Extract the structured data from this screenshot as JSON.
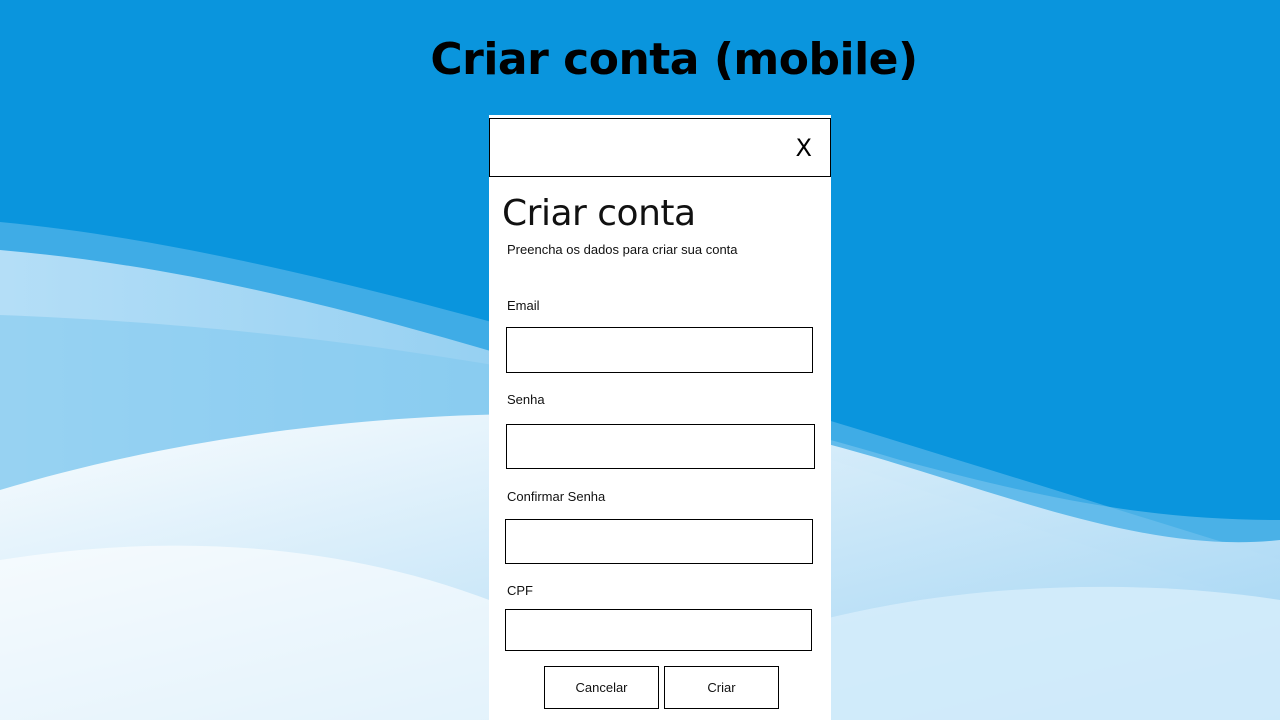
{
  "slide": {
    "title": "Criar conta (mobile)"
  },
  "dialog": {
    "close_label": "X",
    "title": "Criar conta",
    "subtitle": "Preencha os dados para criar sua conta",
    "fields": [
      {
        "label": "Email",
        "value": "",
        "placeholder": ""
      },
      {
        "label": "Senha",
        "value": "",
        "placeholder": ""
      },
      {
        "label": "Confirmar Senha",
        "value": "",
        "placeholder": ""
      },
      {
        "label": "CPF",
        "value": "",
        "placeholder": ""
      }
    ],
    "cancel_label": "Cancelar",
    "create_label": "Criar"
  },
  "colors": {
    "background_blue": "#0a95dd",
    "wave_light": "#e8f4fc"
  }
}
